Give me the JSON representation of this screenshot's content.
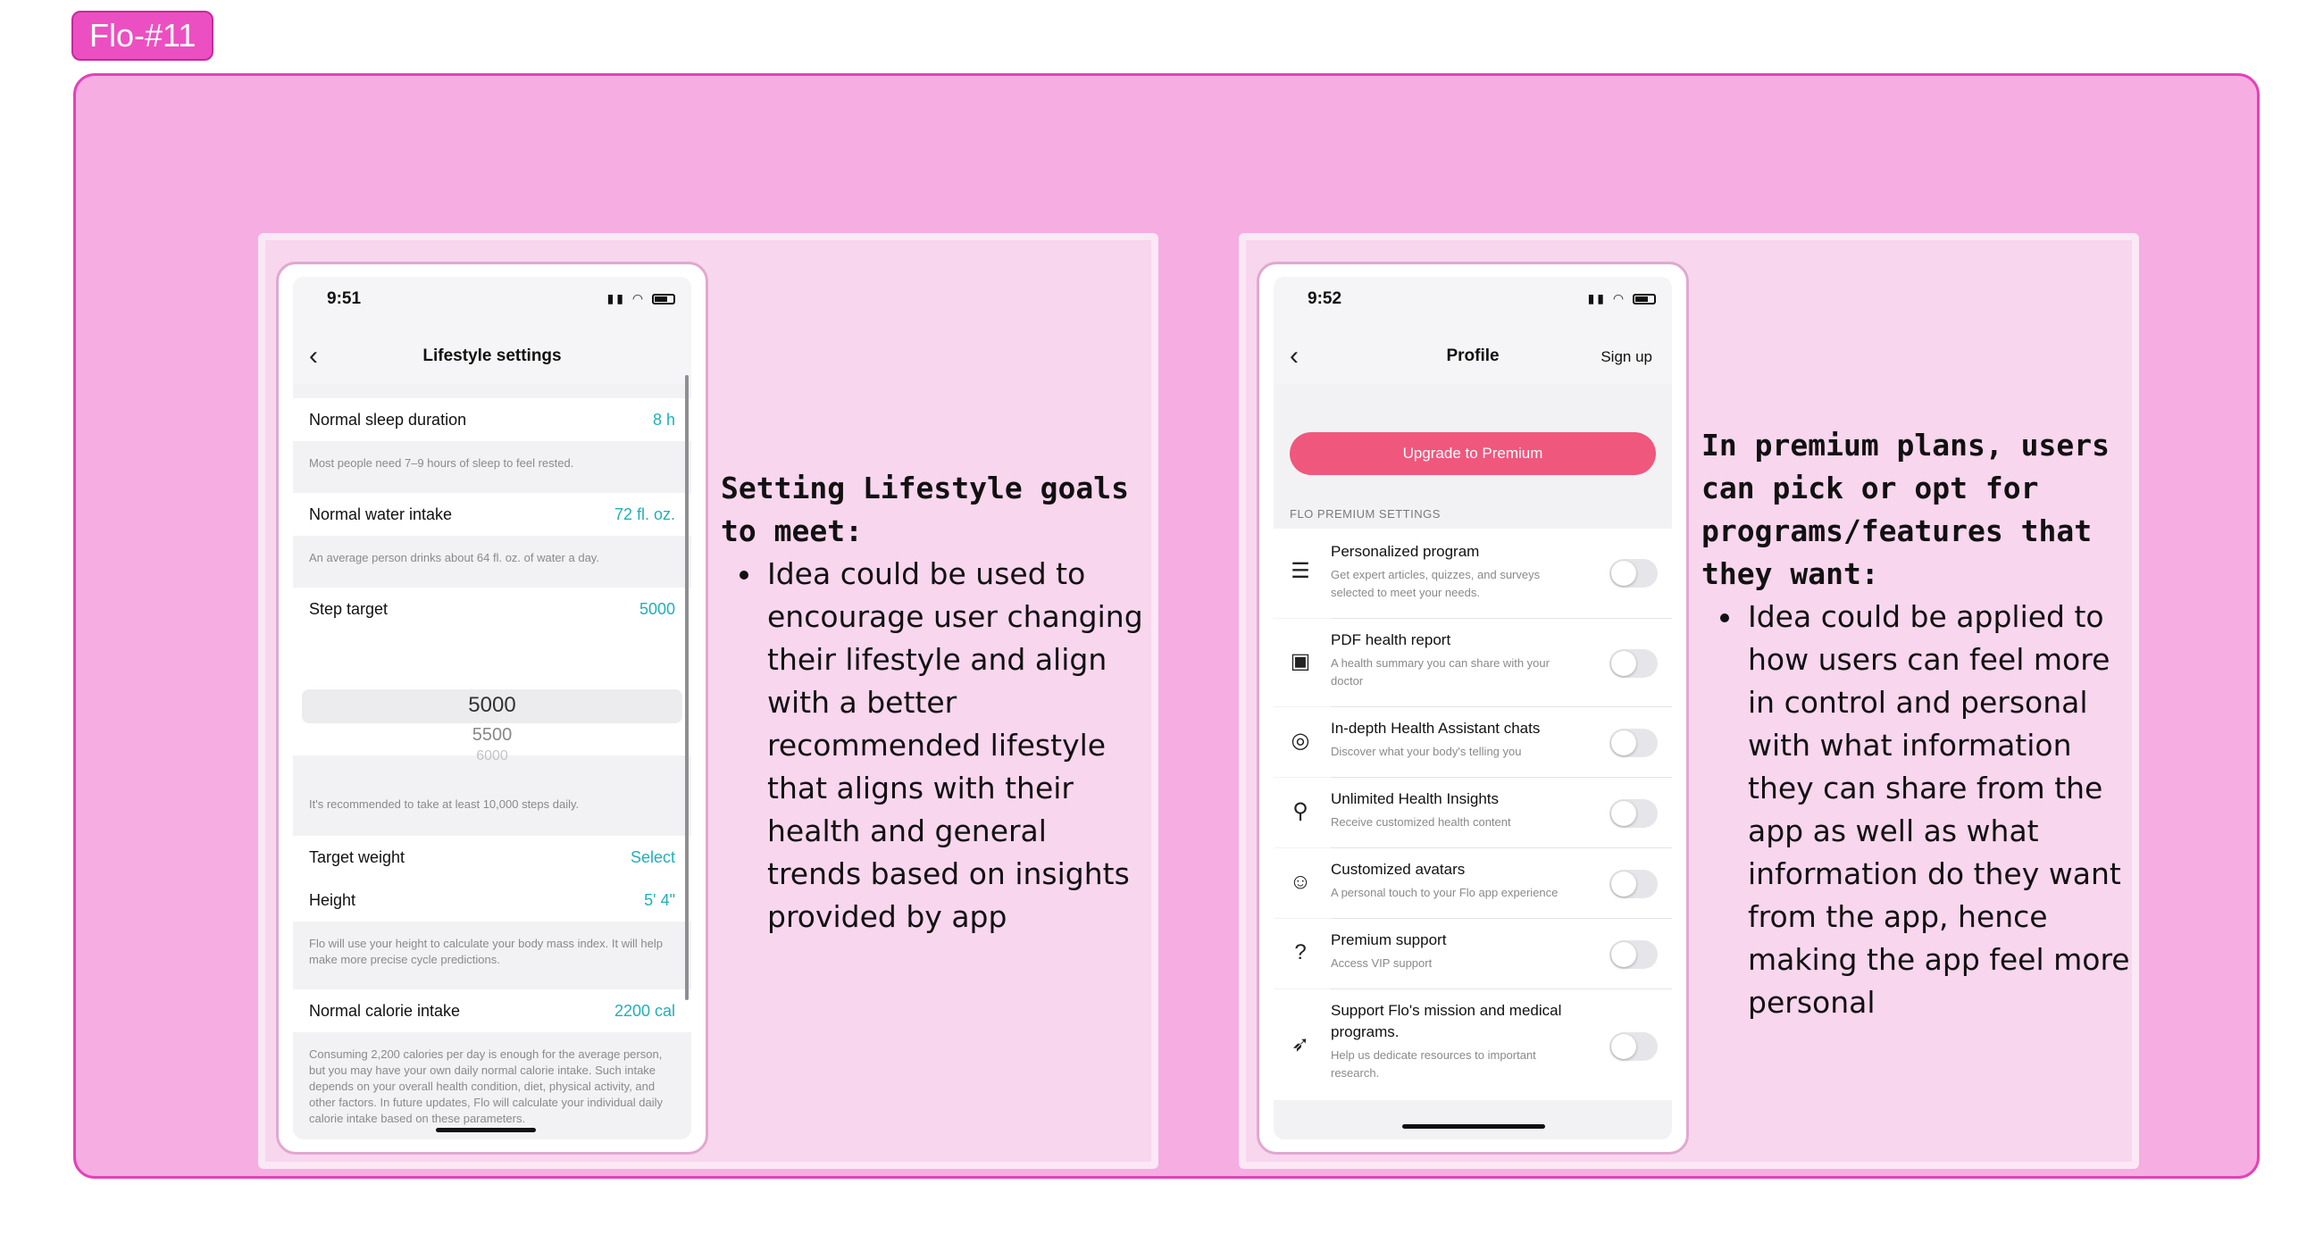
{
  "frame_label": "Flo-#11",
  "left": {
    "status_time": "9:51",
    "nav_title": "Lifestyle settings",
    "rows": {
      "sleep": {
        "label": "Normal sleep duration",
        "value": "8 h"
      },
      "sleep_note": "Most people need 7–9 hours of sleep to feel rested.",
      "water": {
        "label": "Normal water intake",
        "value": "72 fl. oz."
      },
      "water_note": "An average person drinks about 64 fl. oz. of water a day.",
      "step": {
        "label": "Step target",
        "value": "5000"
      },
      "picker": [
        "5000",
        "5500",
        "6000"
      ],
      "step_note": "It's recommended to take at least 10,000 steps daily.",
      "weight": {
        "label": "Target weight",
        "value": "Select"
      },
      "height": {
        "label": "Height",
        "value": "5' 4\""
      },
      "height_note": "Flo will use your height to calculate your body mass index. It will help make more precise cycle predictions.",
      "calorie": {
        "label": "Normal calorie intake",
        "value": "2200 cal"
      },
      "calorie_note": "Consuming 2,200 calories per day is enough for the average person, but you may have your own daily normal calorie intake. Such intake depends on your overall health condition, diet, physical activity, and other factors. In future updates, Flo will calculate your individual daily calorie intake based on these parameters."
    },
    "annotation": {
      "heading": "Setting Lifestyle goals to meet:",
      "bullet": "Idea could be used to encourage user changing their lifestyle and align with a better recommended lifestyle that aligns with their health and general trends based on insights provided by app"
    }
  },
  "right": {
    "status_time": "9:52",
    "nav_title": "Profile",
    "nav_action": "Sign up",
    "premium_button": "Upgrade to Premium",
    "section_title": "FLO PREMIUM SETTINGS",
    "features": [
      {
        "icon": "list-icon",
        "title": "Personalized program",
        "subtitle": "Get expert articles, quizzes, and surveys selected to meet your needs."
      },
      {
        "icon": "report-icon",
        "title": "PDF health report",
        "subtitle": "A health summary you can share with your doctor"
      },
      {
        "icon": "chat-icon",
        "title": "In-depth Health Assistant chats",
        "subtitle": "Discover what your body's telling you"
      },
      {
        "icon": "lightbulb-icon",
        "title": "Unlimited Health Insights",
        "subtitle": "Receive customized health content"
      },
      {
        "icon": "avatar-icon",
        "title": "Customized avatars",
        "subtitle": "A personal touch to your Flo app experience"
      },
      {
        "icon": "help-icon",
        "title": "Premium support",
        "subtitle": "Access VIP support"
      },
      {
        "icon": "rocket-icon",
        "title": "Support Flo's mission and medical programs.",
        "subtitle": "Help us dedicate resources to important research."
      }
    ],
    "annotation": {
      "heading": "In premium plans, users can pick or opt for programs/features that they want:",
      "bullet": "Idea could be applied to how users can feel more in control and personal with what information they can share from the app as well as what information do they want from the app, hence making the app feel more personal"
    }
  },
  "colors": {
    "board": "#f6ade2",
    "accent_teal": "#1fb0b7",
    "premium_pink": "#f0577d",
    "tag_pink": "#ec4fc1"
  }
}
